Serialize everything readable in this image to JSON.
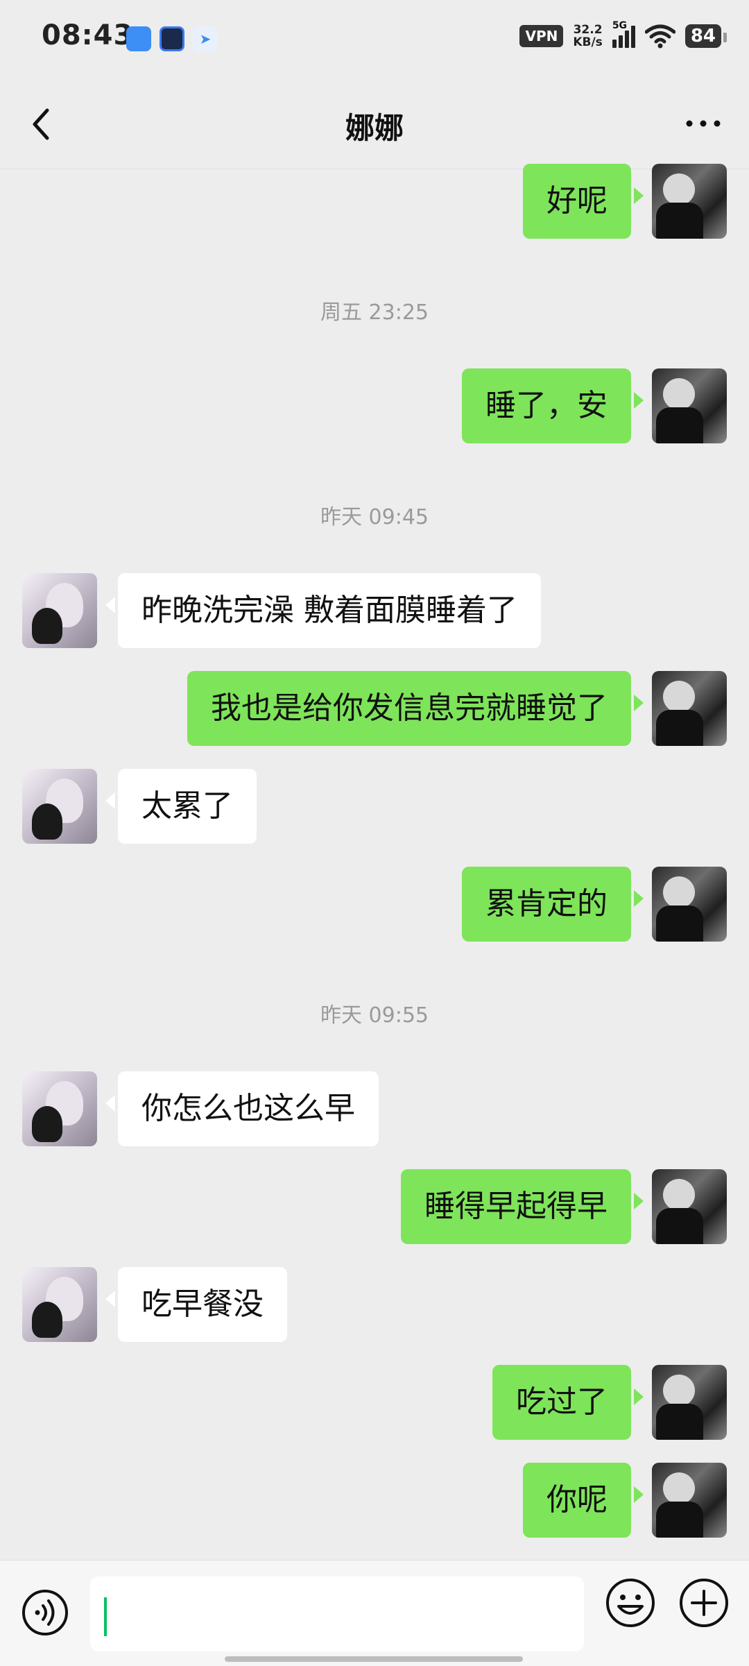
{
  "status_bar": {
    "time": "08:43",
    "vpn": "VPN",
    "net_speed_value": "32.2",
    "net_speed_unit": "KB/s",
    "network": "5G",
    "battery": "84"
  },
  "header": {
    "title": "娜娜"
  },
  "timestamps": [
    "周五 23:25",
    "昨天 09:45",
    "昨天 09:55"
  ],
  "messages": [
    {
      "from": "me",
      "text": "好呢"
    },
    {
      "from": "me",
      "text": "睡了，安"
    },
    {
      "from": "her",
      "text": "昨晚洗完澡 敷着面膜睡着了"
    },
    {
      "from": "me",
      "text": "我也是给你发信息完就睡觉了"
    },
    {
      "from": "her",
      "text": "太累了"
    },
    {
      "from": "me",
      "text": "累肯定的"
    },
    {
      "from": "her",
      "text": "你怎么也这么早"
    },
    {
      "from": "me",
      "text": "睡得早起得早"
    },
    {
      "from": "her",
      "text": "吃早餐没"
    },
    {
      "from": "me",
      "text": "吃过了"
    },
    {
      "from": "me",
      "text": "你呢"
    }
  ],
  "input_bar": {
    "value": ""
  },
  "colors": {
    "sent_bubble": "#7ee45a",
    "received_bubble": "#ffffff",
    "background": "#ededed",
    "cursor": "#07c160"
  },
  "icons": [
    "back-arrow-icon",
    "more-dots-icon",
    "voice-icon",
    "emoji-icon",
    "plus-icon"
  ]
}
